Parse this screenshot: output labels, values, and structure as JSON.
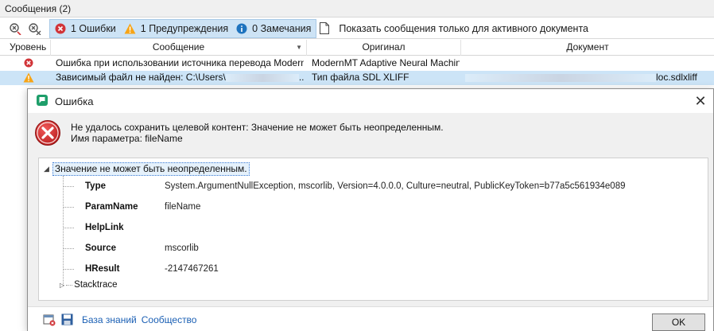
{
  "panel": {
    "title": "Сообщения (2)"
  },
  "toolbar": {
    "errors_label": "1 Ошибки",
    "warnings_label": "1 Предупреждения",
    "notes_label": "0 Замечания",
    "active_only_label": "Показать сообщения только для активного документа"
  },
  "grid": {
    "columns": [
      "Уровень",
      "Сообщение",
      "Оригинал",
      "Документ"
    ],
    "rows": [
      {
        "level": "error",
        "message": "Ошибка при использовании источника перевода Modern...",
        "origin": "ModernMT Adaptive Neural Machin...",
        "document": ""
      },
      {
        "level": "warning",
        "message": "Зависимый файл не найден: C:\\Users\\",
        "message_tail": "...",
        "origin": "Тип файла SDL XLIFF",
        "document": "loc.sdlxliff"
      }
    ]
  },
  "dialog": {
    "title": "Ошибка",
    "message_line1": "Не удалось сохранить целевой контент: Значение не может быть неопределенным.",
    "message_line2": "Имя параметра: fileName",
    "tree_root": "Значение не может быть неопределенным.",
    "properties": [
      {
        "key": "Type",
        "value": "System.ArgumentNullException, mscorlib, Version=4.0.0.0, Culture=neutral, PublicKeyToken=b77a5c561934e089"
      },
      {
        "key": "ParamName",
        "value": "fileName"
      },
      {
        "key": "HelpLink",
        "value": ""
      },
      {
        "key": "Source",
        "value": "mscorlib"
      },
      {
        "key": "HResult",
        "value": "-2147467261"
      }
    ],
    "stacktrace_label": "Stacktrace",
    "footer": {
      "knowledge_base": "База знаний",
      "community": "Сообщество",
      "ok": "OK"
    }
  },
  "colors": {
    "error": "#d13438",
    "warning": "#f7a416",
    "info": "#1e73be",
    "selection": "#cce4f7",
    "link": "#1a5fb4"
  }
}
